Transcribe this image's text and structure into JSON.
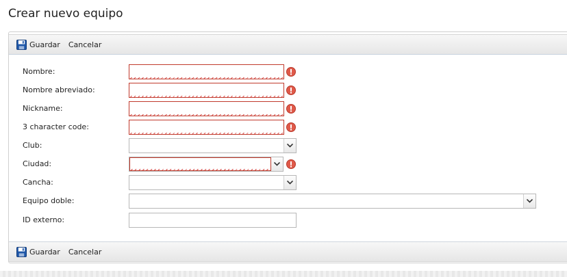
{
  "page": {
    "title": "Crear nuevo equipo"
  },
  "toolbar": {
    "save_label": "Guardar",
    "cancel_label": "Cancelar"
  },
  "form": {
    "nombre": {
      "label": "Nombre:",
      "value": "",
      "invalid": true
    },
    "nombre_abreviado": {
      "label": "Nombre abreviado:",
      "value": "",
      "invalid": true
    },
    "nickname": {
      "label": "Nickname:",
      "value": "",
      "invalid": true
    },
    "code": {
      "label": "3 character code:",
      "value": "",
      "invalid": true
    },
    "club": {
      "label": "Club:",
      "selected": ""
    },
    "ciudad": {
      "label": "Ciudad:",
      "selected": "",
      "invalid": true
    },
    "cancha": {
      "label": "Cancha:",
      "selected": ""
    },
    "equipo_doble": {
      "label": "Equipo doble:",
      "selected": ""
    },
    "id_externo": {
      "label": "ID externo:",
      "value": ""
    }
  },
  "colors": {
    "error": "#e05a4a",
    "invalid_border": "#c0392b",
    "save_icon": "#1f57a8"
  },
  "icons": {
    "save": "floppy-disk-icon",
    "error": "exclamation-circle-icon",
    "dropdown": "chevron-down-icon"
  }
}
